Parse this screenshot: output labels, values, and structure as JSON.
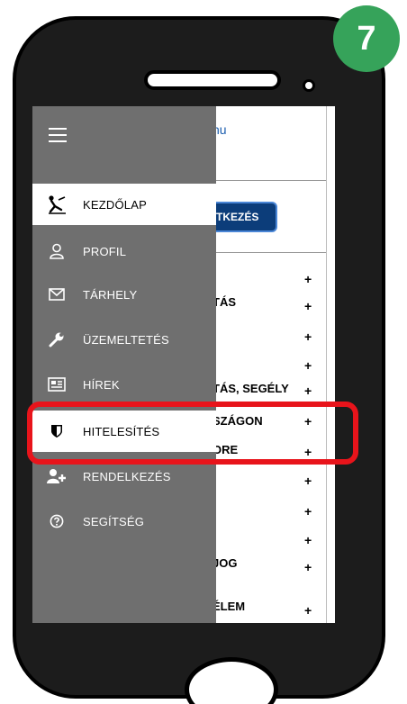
{
  "step_badge": "7",
  "page": {
    "domain": "hu",
    "login_label": "TKEZÉS",
    "rows": [
      {
        "text": "",
        "plus": "+"
      },
      {
        "text": "TÁS",
        "plus": "+"
      },
      {
        "text": "",
        "plus": "+"
      },
      {
        "text": "",
        "plus": "+"
      },
      {
        "text": "TÁS, SEGÉLY",
        "plus": "+"
      },
      {
        "text": "SZÁGON",
        "plus": "+"
      },
      {
        "text": "ORE",
        "plus": "+"
      },
      {
        "text": "",
        "plus": "+"
      },
      {
        "text": "",
        "plus": "+"
      },
      {
        "text": "",
        "plus": "+"
      },
      {
        "text": "JOG",
        "plus": "+"
      },
      {
        "text": "ÉLEM",
        "plus": "+"
      }
    ]
  },
  "drawer": {
    "menu_icon": "hamburger-icon",
    "items": [
      {
        "label": "KEZDŐLAP",
        "icon": "home-person-icon",
        "active": true
      },
      {
        "label": "PROFIL",
        "icon": "user-icon"
      },
      {
        "label": "TÁRHELY",
        "icon": "envelope-icon"
      },
      {
        "label": "ÜZEMELTETÉS",
        "icon": "wrench-icon"
      },
      {
        "label": "HÍREK",
        "icon": "newspaper-icon"
      },
      {
        "label": "HITELESÍTÉS",
        "icon": "shield-icon"
      },
      {
        "label": "RENDELKEZÉS",
        "icon": "add-user-icon"
      },
      {
        "label": "SEGÍTSÉG",
        "icon": "help-icon"
      }
    ]
  },
  "colors": {
    "drawer_bg": "#6f6f6f",
    "badge": "#36a35a",
    "highlight": "#e8141b",
    "login_button": "#0c3d7a"
  }
}
